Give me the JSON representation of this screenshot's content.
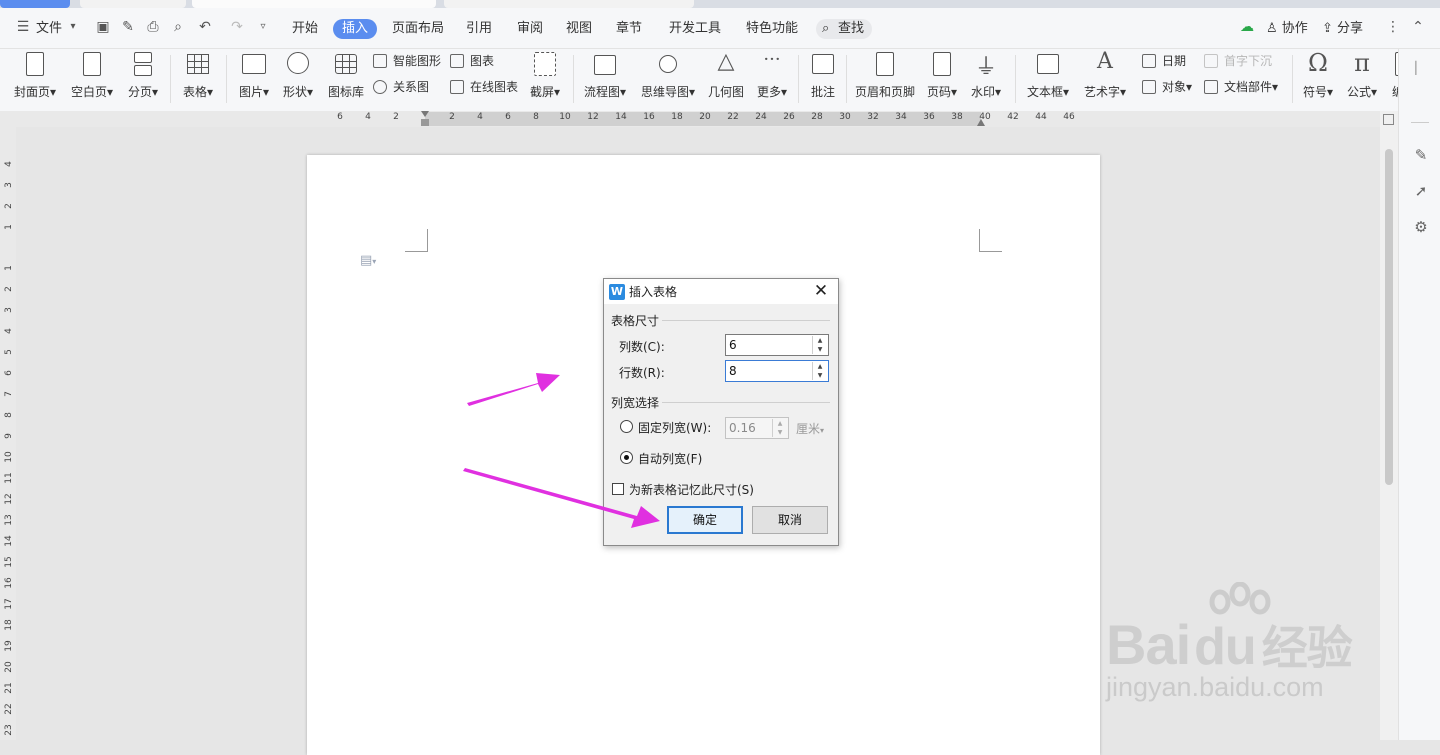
{
  "menubar": {
    "file_label": "文件",
    "tabs": [
      {
        "label": "开始"
      },
      {
        "label": "插入"
      },
      {
        "label": "页面布局"
      },
      {
        "label": "引用"
      },
      {
        "label": "审阅"
      },
      {
        "label": "视图"
      },
      {
        "label": "章节"
      },
      {
        "label": "开发工具"
      },
      {
        "label": "特色功能"
      }
    ],
    "active_tab": "插入",
    "search_label": "查找",
    "collab_label": "协作",
    "share_label": "分享"
  },
  "ribbon": {
    "cover_page": "封面页",
    "blank_page": "空白页",
    "page_break": "分页",
    "table": "表格",
    "picture": "图片",
    "shape": "形状",
    "icon_library": "图标库",
    "smart_art": "智能图形",
    "chart": "图表",
    "relation_chart": "关系图",
    "online_chart": "在线图表",
    "screenshot": "截屏",
    "flowchart": "流程图",
    "mindmap": "思维导图",
    "geometry": "几何图",
    "more": "更多",
    "comment": "批注",
    "header_footer": "页眉和页脚",
    "page_number": "页码",
    "watermark": "水印",
    "textbox": "文本框",
    "wordart": "艺术字",
    "date": "日期",
    "object": "对象",
    "drop_cap": "首字下沉",
    "doc_parts": "文档部件",
    "symbol": "符号",
    "formula": "公式",
    "numbering": "编号"
  },
  "hruler_labels": [
    "6",
    "4",
    "2",
    "2",
    "4",
    "6",
    "8",
    "10",
    "12",
    "14",
    "16",
    "18",
    "20",
    "22",
    "24",
    "26",
    "28",
    "30",
    "32",
    "34",
    "36",
    "38",
    "40",
    "42",
    "44",
    "46"
  ],
  "vruler_labels": [
    "4",
    "3",
    "2",
    "1",
    "1",
    "2",
    "3",
    "4",
    "5",
    "6",
    "7",
    "8",
    "9",
    "10",
    "11",
    "12",
    "13",
    "14",
    "15",
    "16",
    "17",
    "18",
    "19",
    "20",
    "21",
    "22",
    "23"
  ],
  "dialog": {
    "title": "插入表格",
    "size_group": "表格尺寸",
    "cols_label": "列数(C):",
    "cols_value": "6",
    "rows_label": "行数(R):",
    "rows_value": "8",
    "width_group": "列宽选择",
    "fixed_label": "固定列宽(W):",
    "fixed_value": "0.16",
    "fixed_unit": "厘米",
    "auto_label": "自动列宽(F)",
    "auto_selected": true,
    "remember_label": "为新表格记忆此尺寸(S)",
    "remember_checked": false,
    "ok_label": "确定",
    "cancel_label": "取消"
  },
  "watermark": {
    "brand": "Bai",
    "brand_cn": "经验",
    "url": "jingyan.baidu.com"
  },
  "colors": {
    "accent": "#5b8def",
    "arrow": "#e030e0",
    "dialog_bg": "#f0f0f0",
    "focus_border": "#3a7bd5"
  }
}
